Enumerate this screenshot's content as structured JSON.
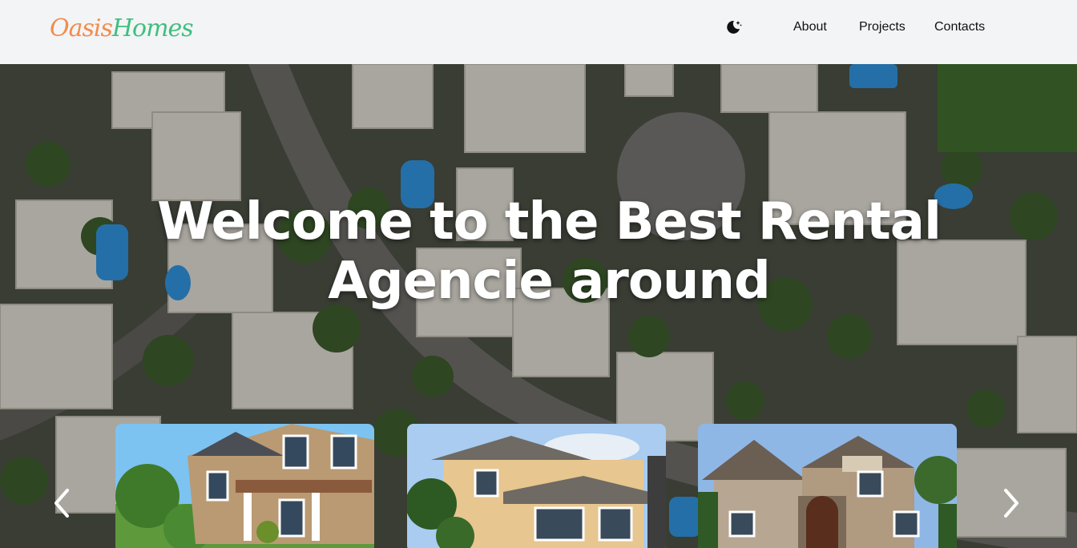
{
  "brand": {
    "part1": "Oasis",
    "part2": "Homes",
    "color1": "#f28c4b",
    "color2": "#3fbf7f"
  },
  "nav": {
    "theme_icon": "moon-icon",
    "links": [
      "About",
      "Projects",
      "Contacts"
    ]
  },
  "hero": {
    "title": "Welcome to the Best Rental Agencie around",
    "prev_icon": "chevron-left-icon",
    "next_icon": "chevron-right-icon"
  },
  "cards": [
    {
      "icon": "house-photo-1"
    },
    {
      "icon": "house-photo-2"
    },
    {
      "icon": "house-photo-3"
    }
  ]
}
